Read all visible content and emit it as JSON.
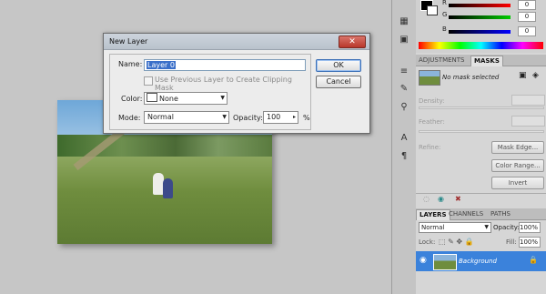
{
  "dialog": {
    "title": "New Layer",
    "close_label": "✕",
    "name_label": "Name:",
    "name_value": "Layer 0",
    "clip_label": "Use Previous Layer to Create Clipping Mask",
    "color_label": "Color:",
    "color_value": "None",
    "mode_label": "Mode:",
    "mode_value": "Normal",
    "opacity_label": "Opacity:",
    "opacity_value": "100",
    "opacity_unit": "%",
    "ok_label": "OK",
    "cancel_label": "Cancel"
  },
  "color_panel": {
    "channels": [
      {
        "label": "R",
        "value": "0",
        "color": "#e02020"
      },
      {
        "label": "G",
        "value": "0",
        "color": "#20b020"
      },
      {
        "label": "B",
        "value": "0",
        "color": "#2040e0"
      }
    ]
  },
  "masks_panel": {
    "tabs": [
      "ADJUSTMENTS",
      "MASKS"
    ],
    "status": "No mask selected",
    "density_label": "Density:",
    "feather_label": "Feather:",
    "refine_label": "Refine:",
    "mask_edge_label": "Mask Edge...",
    "color_range_label": "Color Range...",
    "invert_label": "Invert"
  },
  "layers_panel": {
    "tabs": [
      "LAYERS",
      "CHANNELS",
      "PATHS"
    ],
    "blend_mode": "Normal",
    "opacity_label": "Opacity:",
    "opacity_value": "100%",
    "lock_label": "Lock:",
    "fill_label": "Fill:",
    "fill_value": "100%",
    "layer_name": "Background"
  },
  "toolstrip": {
    "icons": [
      "swatches-icon",
      "history-icon",
      "actions-icon",
      "brush-icon",
      "stamp-icon",
      "tools-icon",
      "character-icon",
      "paragraph-icon"
    ]
  }
}
